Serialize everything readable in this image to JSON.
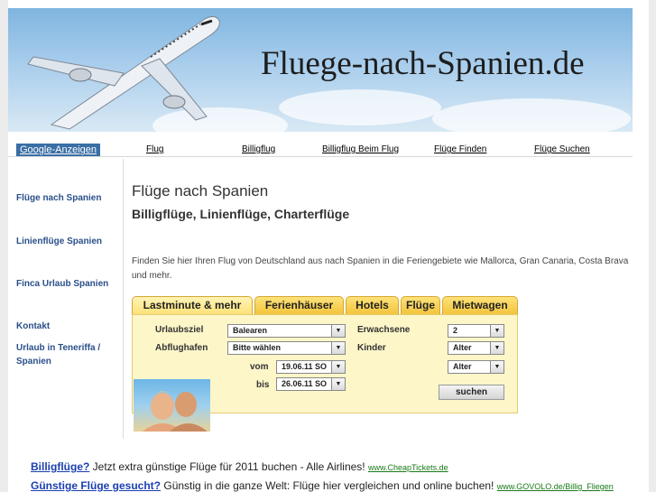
{
  "header": {
    "site_title": "Fluege-nach-Spanien.de"
  },
  "topnav": {
    "ads_label": "Google-Anzeigen",
    "links": [
      "Flug",
      "Billigflug",
      "Billigflug Beim Flug",
      "Flüge Finden",
      "Flüge Suchen"
    ]
  },
  "sidebar": {
    "items": [
      "Flüge nach Spanien",
      "Linienflüge Spanien",
      "Finca Urlaub Spanien",
      "Kontakt",
      "Urlaub in Teneriffa / Spanien"
    ]
  },
  "main": {
    "title": "Flüge nach Spanien",
    "subtitle": "Billigflüge, Linienflüge, Charterflüge",
    "intro": "Finden Sie hier Ihren Flug von Deutschland aus nach Spanien in die Feriengebiete wie Mallorca, Gran Canaria, Costa Brava und mehr."
  },
  "widget": {
    "tabs": [
      "Lastminute & mehr",
      "Ferienhäuser",
      "Hotels",
      "Flüge",
      "Mietwagen"
    ],
    "urlaubsziel_label": "Urlaubsziel",
    "urlaubsziel_value": "Balearen",
    "abflughafen_label": "Abflughafen",
    "abflughafen_value": "Bitte wählen",
    "vom_label": "vom",
    "vom_value": "19.06.11 SO",
    "bis_label": "bis",
    "bis_value": "26.06.11 SO",
    "erwachsene_label": "Erwachsene",
    "erwachsene_value": "2",
    "kinder_label": "Kinder",
    "kinder_value_1": "Alter",
    "kinder_value_2": "Alter",
    "search_button": "suchen"
  },
  "ads": [
    {
      "title": "Billigflüge?",
      "text": "Jetzt extra günstige Flüge für 2011 buchen - Alle Airlines!",
      "url": "www.CheapTickets.de"
    },
    {
      "title": "Günstige Flüge gesucht?",
      "text": "Günstig in die ganze Welt: Flüge hier vergleichen und online buchen!",
      "url": "www.GOVOLO.de/Billig_Fliegen"
    }
  ],
  "colors": {
    "accent_blue": "#3a6ea5",
    "link_blue": "#2a4f8a",
    "tab_yellow": "#f3c43c",
    "panel_yellow": "#fcf6c8"
  }
}
